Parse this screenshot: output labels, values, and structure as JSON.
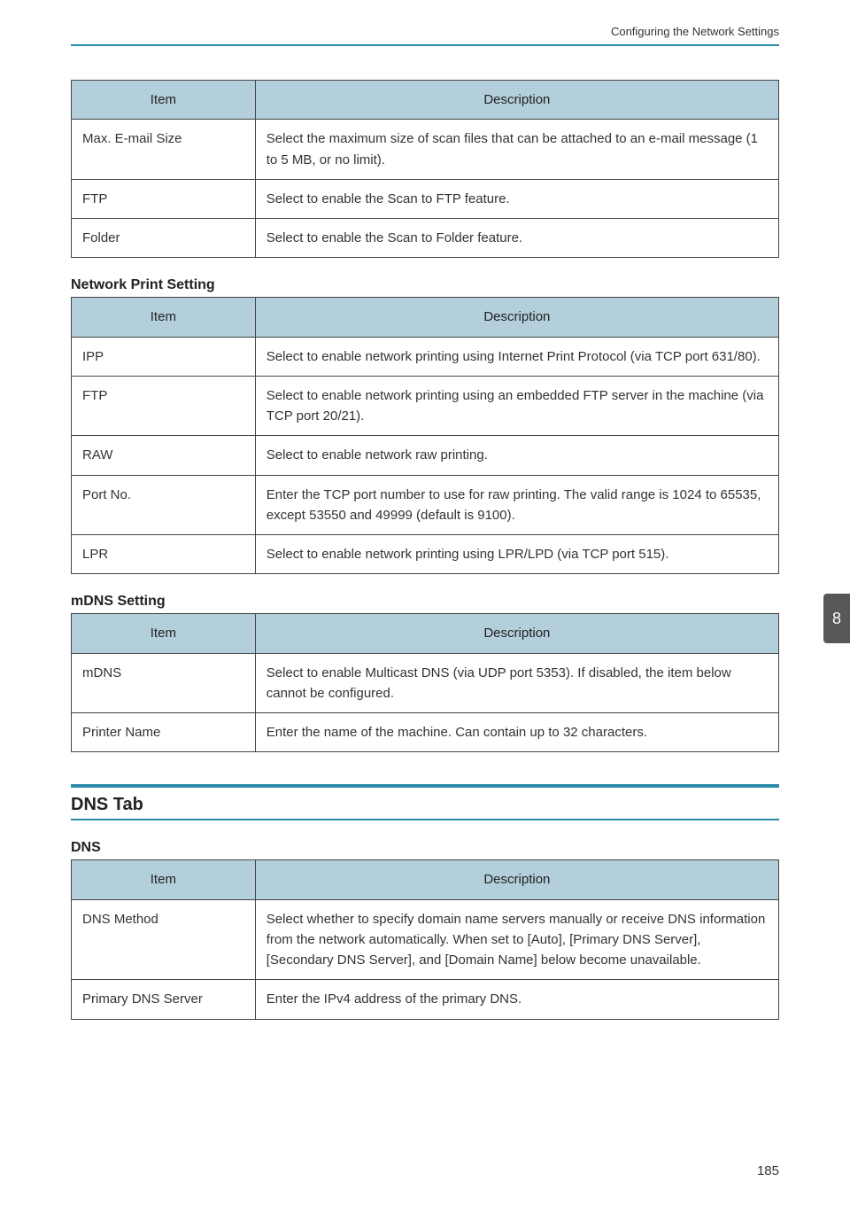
{
  "header": {
    "running_title": "Configuring the Network Settings"
  },
  "columns": {
    "item": "Item",
    "desc": "Description"
  },
  "table_scan": {
    "rows": [
      {
        "item": "Max. E-mail Size",
        "desc": "Select the maximum size of scan files that can be attached to an e-mail message (1 to 5 MB, or no limit)."
      },
      {
        "item": "FTP",
        "desc": "Select to enable the Scan to FTP feature."
      },
      {
        "item": "Folder",
        "desc": "Select to enable the Scan to Folder feature."
      }
    ]
  },
  "sec_netprint": {
    "title": "Network Print Setting"
  },
  "table_netprint": {
    "rows": [
      {
        "item": "IPP",
        "desc": "Select to enable network printing using Internet Print Protocol (via TCP port 631/80)."
      },
      {
        "item": "FTP",
        "desc": "Select to enable network printing using an embedded FTP server in the machine (via TCP port 20/21)."
      },
      {
        "item": "RAW",
        "desc": "Select to enable network raw printing."
      },
      {
        "item": "Port No.",
        "desc": "Enter the TCP port number to use for raw printing. The valid range is 1024 to 65535, except 53550 and 49999 (default is 9100)."
      },
      {
        "item": "LPR",
        "desc": "Select to enable network printing using LPR/LPD (via TCP port 515)."
      }
    ]
  },
  "sec_mdns": {
    "title": "mDNS Setting"
  },
  "table_mdns": {
    "rows": [
      {
        "item": "mDNS",
        "desc": "Select to enable Multicast DNS (via UDP port 5353). If disabled, the item below cannot be configured."
      },
      {
        "item": "Printer Name",
        "desc": "Enter the name of the machine. Can contain up to 32 characters."
      }
    ]
  },
  "sec_dnstab": {
    "title": "DNS Tab"
  },
  "sec_dns": {
    "title": "DNS"
  },
  "table_dns": {
    "rows": [
      {
        "item": "DNS Method",
        "desc": "Select whether to specify domain name servers manually or receive DNS information from the network automatically. When set to [Auto], [Primary DNS Server], [Secondary DNS Server], and [Domain Name] below become unavailable."
      },
      {
        "item": "Primary DNS Server",
        "desc": "Enter the IPv4 address of the primary DNS."
      }
    ]
  },
  "side_tab": {
    "number": "8"
  },
  "footer": {
    "page": "185"
  }
}
